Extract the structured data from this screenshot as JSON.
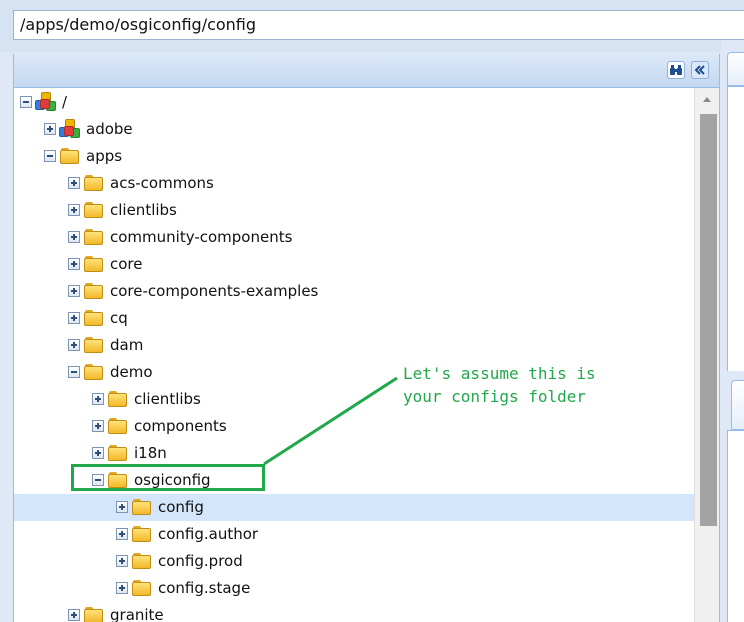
{
  "address_bar": {
    "path": "/apps/demo/osgiconfig/config"
  },
  "tree_toolbar": {
    "find_icon": "binoculars-icon",
    "collapse_icon": "double-chevron-left-icon"
  },
  "tree": {
    "nodes": [
      {
        "label": "/",
        "icon": "repository-icon",
        "expander": "collapse",
        "depth": 0
      },
      {
        "label": "adobe",
        "icon": "repository-icon",
        "expander": "expand",
        "depth": 1
      },
      {
        "label": "apps",
        "icon": "folder-icon",
        "expander": "collapse",
        "depth": 1
      },
      {
        "label": "acs-commons",
        "icon": "folder-icon",
        "expander": "expand",
        "depth": 2
      },
      {
        "label": "clientlibs",
        "icon": "folder-icon",
        "expander": "expand",
        "depth": 2
      },
      {
        "label": "community-components",
        "icon": "folder-icon",
        "expander": "expand",
        "depth": 2
      },
      {
        "label": "core",
        "icon": "folder-icon",
        "expander": "expand",
        "depth": 2
      },
      {
        "label": "core-components-examples",
        "icon": "folder-icon",
        "expander": "expand",
        "depth": 2
      },
      {
        "label": "cq",
        "icon": "folder-icon",
        "expander": "expand",
        "depth": 2
      },
      {
        "label": "dam",
        "icon": "folder-icon",
        "expander": "expand",
        "depth": 2
      },
      {
        "label": "demo",
        "icon": "folder-icon",
        "expander": "collapse",
        "depth": 2
      },
      {
        "label": "clientlibs",
        "icon": "folder-icon",
        "expander": "expand",
        "depth": 3
      },
      {
        "label": "components",
        "icon": "folder-icon",
        "expander": "expand",
        "depth": 3
      },
      {
        "label": "i18n",
        "icon": "folder-icon",
        "expander": "expand",
        "depth": 3
      },
      {
        "label": "osgiconfig",
        "icon": "folder-icon",
        "expander": "collapse",
        "depth": 3
      },
      {
        "label": "config",
        "icon": "folder-icon",
        "expander": "expand",
        "depth": 4,
        "selected": true
      },
      {
        "label": "config.author",
        "icon": "folder-icon",
        "expander": "expand",
        "depth": 4
      },
      {
        "label": "config.prod",
        "icon": "folder-icon",
        "expander": "expand",
        "depth": 4
      },
      {
        "label": "config.stage",
        "icon": "folder-icon",
        "expander": "expand",
        "depth": 4
      },
      {
        "label": "granite",
        "icon": "folder-icon",
        "expander": "expand",
        "depth": 2
      }
    ]
  },
  "annotation": {
    "text": "Let's assume this is\nyour configs folder",
    "color": "#21a84a"
  },
  "colors": {
    "selection": "#d3e6fb",
    "panel_border": "#99bbe8",
    "folder": "#f2b92a"
  }
}
